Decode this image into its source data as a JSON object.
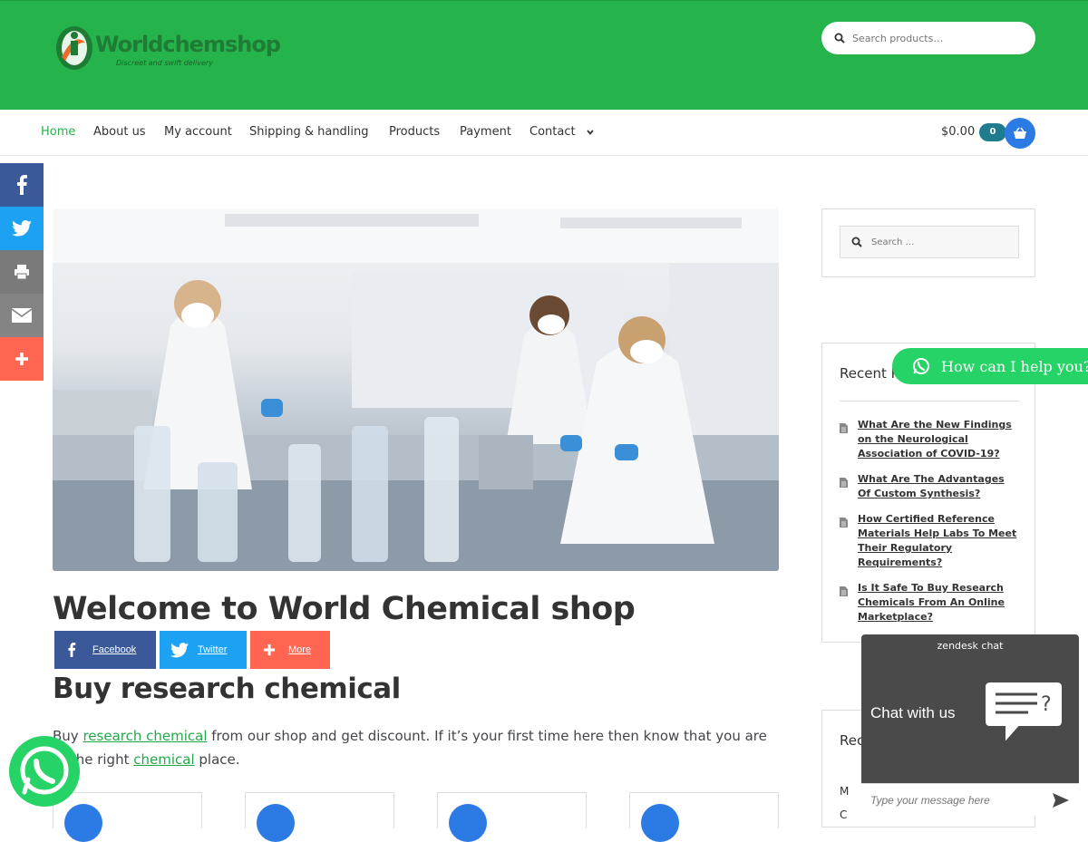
{
  "header": {
    "logo_text": "Worldchemshop",
    "logo_tagline": "Discreet and swift delivery",
    "search_placeholder": "Search products…",
    "search_icon": "search-icon"
  },
  "nav": {
    "items": [
      {
        "label": "Home",
        "active": true
      },
      {
        "label": "About us"
      },
      {
        "label": "My account"
      },
      {
        "label": "Shipping & handling"
      },
      {
        "label": "Products"
      },
      {
        "label": "Payment"
      },
      {
        "label": "Contact",
        "has_dropdown": true
      }
    ],
    "cart_total": "$0.00",
    "cart_count": "0",
    "cart_icon": "basket-icon"
  },
  "side_share": [
    {
      "icon": "facebook-icon",
      "color": "#3b5998"
    },
    {
      "icon": "twitter-icon",
      "color": "#1da1f2"
    },
    {
      "icon": "print-icon",
      "color": "#7a7a7a"
    },
    {
      "icon": "email-icon",
      "color": "#848484"
    },
    {
      "icon": "plus-icon",
      "color": "#ff6550"
    }
  ],
  "main": {
    "title": "Welcome to World Chemical shop",
    "share_buttons": [
      {
        "label": "Facebook",
        "icon": "facebook-icon",
        "color": "#3b5998"
      },
      {
        "label": "Twitter",
        "icon": "twitter-icon",
        "color": "#1da1f2"
      },
      {
        "label": "More",
        "icon": "plus-icon",
        "color": "#ff6550"
      }
    ],
    "subtitle": "Buy research chemical",
    "intro_1": "Buy ",
    "intro_link_1": "research chemical",
    "intro_2": " from our shop and get discount. If it’s your first time here then know that you are at the right ",
    "intro_link_2": "chemical",
    "intro_3": " place."
  },
  "sidebar": {
    "search_placeholder": "Search …",
    "recent_title": "Recent Posts",
    "recent_posts": [
      "What Are the New Findings on the Neurological Association of COVID-19?",
      "What Are The Advantages Of Custom Synthesis?",
      "How Certified Reference Materials Help Labs To Meet Their Regulatory Requirements?",
      "Is It Safe To Buy Research Chemicals From An Online Marketplace?"
    ],
    "third_title": "Rec",
    "third_items": [
      "M",
      "C"
    ]
  },
  "widgets": {
    "help_label": "How can I help you?",
    "zendesk_brand": "zendesk chat",
    "zendesk_cta": "Chat with us",
    "zendesk_placeholder": "Type your message here"
  },
  "colors": {
    "brand_green": "#25b34b",
    "accent_blue": "#2c7be5",
    "whatsapp": "#25d366"
  }
}
